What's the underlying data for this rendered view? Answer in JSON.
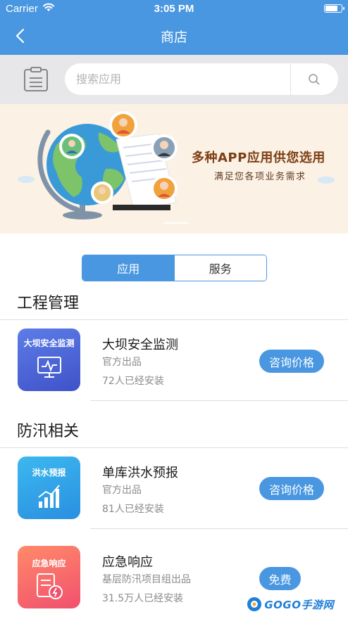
{
  "status_bar": {
    "carrier": "Carrier",
    "time": "3:05 PM",
    "battery_level": 0.85
  },
  "header": {
    "title": "商店",
    "back_icon": "chevron-left-icon"
  },
  "search": {
    "placeholder": "搜索应用",
    "left_icon": "clipboard-icon",
    "search_icon": "search-icon"
  },
  "banner": {
    "title": "多种APP应用供您选用",
    "subtitle": "满足您各项业务需求"
  },
  "tabs": [
    {
      "label": "应用",
      "active": true
    },
    {
      "label": "服务",
      "active": false
    }
  ],
  "sections": [
    {
      "title": "工程管理",
      "apps": [
        {
          "icon_label": "大坝安全监测",
          "name": "大坝安全监测",
          "publisher": "官方出品",
          "installs": "72人已经安装",
          "action": "咨询价格"
        }
      ]
    },
    {
      "title": "防汛相关",
      "apps": [
        {
          "icon_label": "洪水预报",
          "name": "单库洪水预报",
          "publisher": "官方出品",
          "installs": "81人已经安装",
          "action": "咨询价格"
        },
        {
          "icon_label": "应急响应",
          "name": "应急响应",
          "publisher": "基层防汛项目组出品",
          "installs": "31.5万人已经安装",
          "action": "免费"
        }
      ]
    }
  ],
  "watermark": {
    "text": "GOGO手游网"
  },
  "colors": {
    "primary": "#4a97e1",
    "banner_bg": "#fbf1e4",
    "search_bg": "#e7e7e9"
  }
}
